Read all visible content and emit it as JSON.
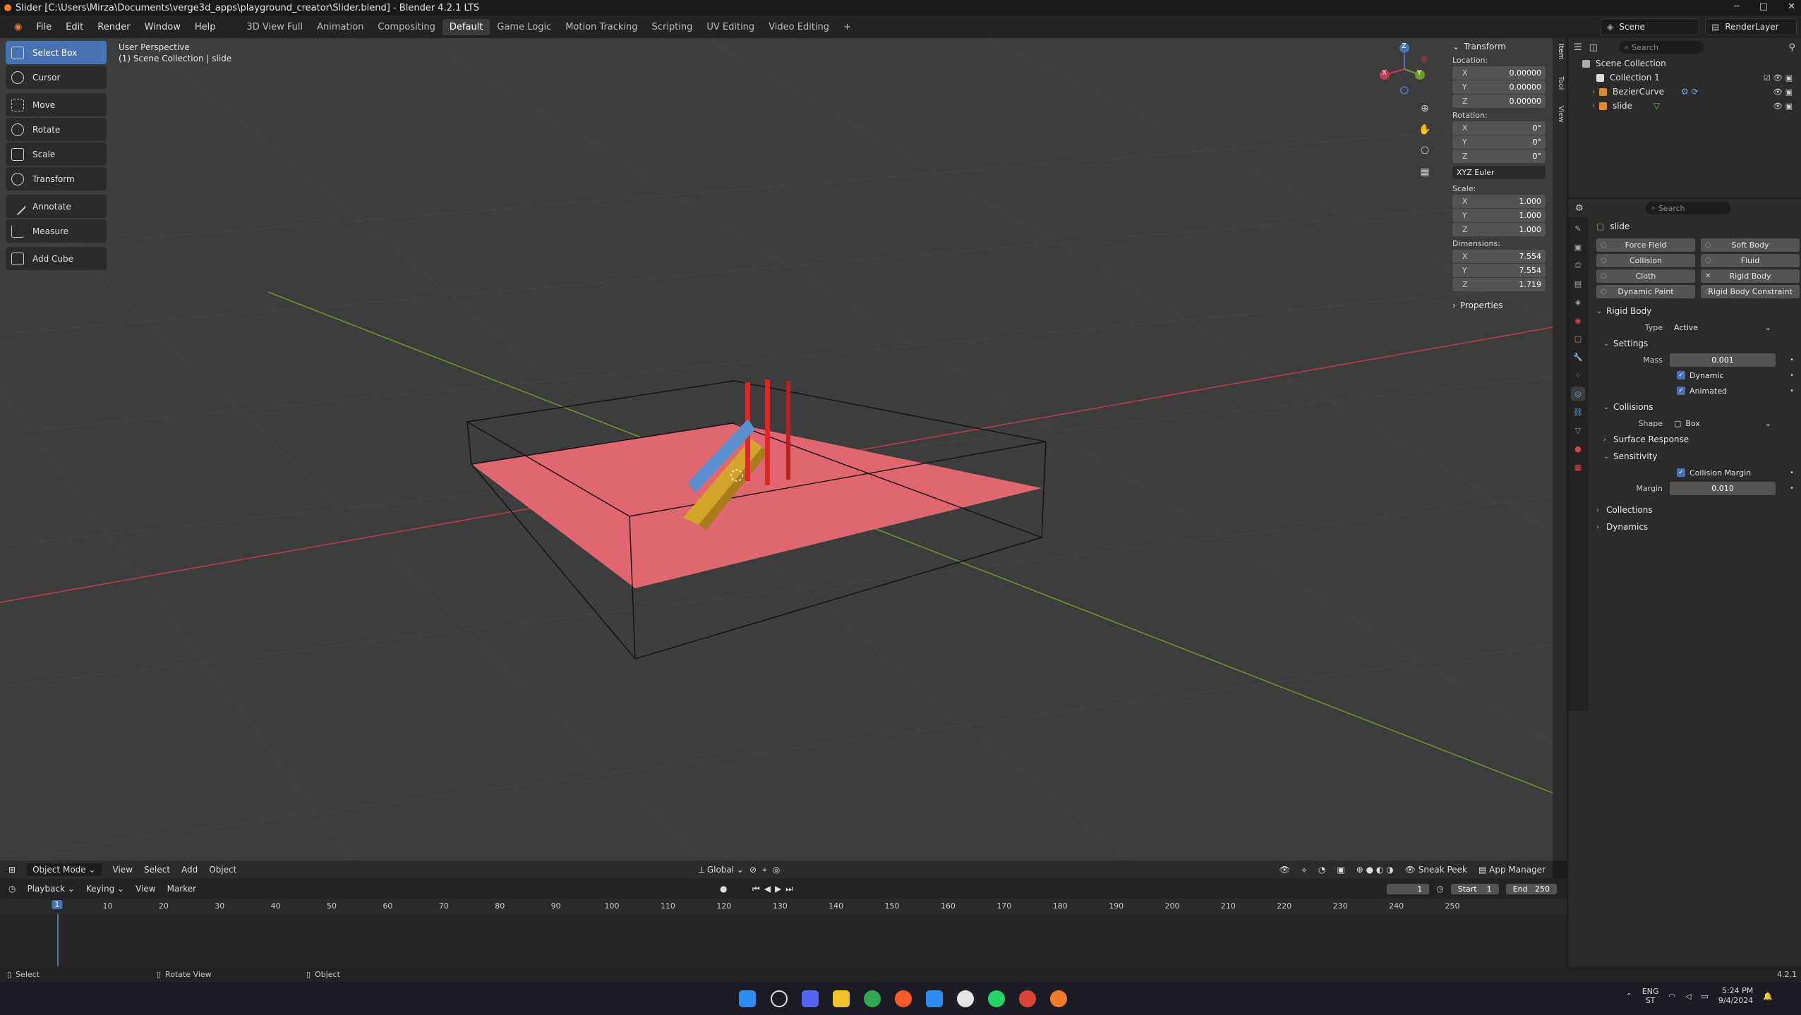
{
  "window": {
    "title": "Slider [C:\\Users\\Mirza\\Documents\\verge3d_apps\\playground_creator\\Slider.blend] - Blender 4.2.1 LTS",
    "btn_min": "─",
    "btn_max": "□",
    "btn_close": "✕"
  },
  "menu": {
    "file": "File",
    "edit": "Edit",
    "render": "Render",
    "window": "Window",
    "help": "Help"
  },
  "workspaces": [
    "3D View Full",
    "Animation",
    "Compositing",
    "Default",
    "Game Logic",
    "Motion Tracking",
    "Scripting",
    "UV Editing",
    "Video Editing"
  ],
  "workspace_add": "+",
  "scene": {
    "name": "Scene",
    "layer": "RenderLayer"
  },
  "viewport": {
    "perspective": "User Perspective",
    "collection": "(1) Scene Collection | slide"
  },
  "tools": {
    "select_box": "Select Box",
    "cursor": "Cursor",
    "move": "Move",
    "rotate": "Rotate",
    "scale": "Scale",
    "transform": "Transform",
    "annotate": "Annotate",
    "measure": "Measure",
    "add_cube": "Add Cube"
  },
  "gizmo": {
    "x": "X",
    "y": "Y",
    "z": "Z"
  },
  "npanel": {
    "header": "Transform",
    "location_label": "Location:",
    "location": {
      "x": "0.00000",
      "y": "0.00000",
      "z": "0.00000"
    },
    "rotation_label": "Rotation:",
    "rotation": {
      "x": "0°",
      "y": "0°",
      "z": "0°"
    },
    "rotation_mode": "XYZ Euler",
    "scale_label": "Scale:",
    "scale": {
      "x": "1.000",
      "y": "1.000",
      "z": "1.000"
    },
    "dimensions_label": "Dimensions:",
    "dimensions": {
      "x": "7.554",
      "y": "7.554",
      "z": "1.719"
    },
    "properties": "Properties",
    "ax_x": "X",
    "ax_y": "Y",
    "ax_z": "Z"
  },
  "side_tabs": {
    "item": "Item",
    "tool": "Tool",
    "view": "View"
  },
  "outliner": {
    "search": "Search",
    "scene_collection": "Scene Collection",
    "collection1": "Collection 1",
    "bezier": "BezierCurve",
    "slide": "slide"
  },
  "properties": {
    "search": "Search",
    "object_name": "slide",
    "physics": {
      "force_field": "Force Field",
      "soft_body": "Soft Body",
      "collision": "Collision",
      "fluid": "Fluid",
      "cloth": "Cloth",
      "rigid_body": "Rigid Body",
      "dynamic_paint": "Dynamic Paint",
      "rigid_body_constraint": "Rigid Body Constraint"
    },
    "rigid_body_header": "Rigid Body",
    "type_label": "Type",
    "type_value": "Active",
    "settings": "Settings",
    "mass_label": "Mass",
    "mass_value": "0.001",
    "dynamic": "Dynamic",
    "animated": "Animated",
    "collisions": "Collisions",
    "shape_label": "Shape",
    "shape_value": "Box",
    "surface_response": "Surface Response",
    "sensitivity": "Sensitivity",
    "collision_margin": "Collision Margin",
    "margin_label": "Margin",
    "margin_value": "0.010",
    "collections": "Collections",
    "dynamics": "Dynamics"
  },
  "viewport_header": {
    "mode": "Object Mode",
    "view": "View",
    "select": "Select",
    "add": "Add",
    "object": "Object",
    "orientation": "Global",
    "sneak_peek": "Sneak Peek",
    "app_manager": "App Manager"
  },
  "timeline": {
    "playback": "Playback",
    "keying": "Keying",
    "view": "View",
    "marker": "Marker",
    "current_frame": "1",
    "start_label": "Start",
    "start": "1",
    "end_label": "End",
    "end": "250",
    "ticks": [
      "10",
      "20",
      "30",
      "40",
      "50",
      "60",
      "70",
      "80",
      "90",
      "100",
      "110",
      "120",
      "130",
      "140",
      "150",
      "160",
      "170",
      "180",
      "190",
      "200",
      "210",
      "220",
      "230",
      "240",
      "250"
    ],
    "cursor": "1"
  },
  "statusbar": {
    "select": "Select",
    "rotate_view": "Rotate View",
    "object": "Object",
    "version": "4.2.1"
  },
  "taskbar": {
    "lang": "ENG",
    "region": "ST",
    "time": "5:24 PM",
    "date": "9/4/2024"
  },
  "colors": {
    "accent": "#4772b3",
    "floor": "#e06670",
    "slide_red": "#d92a2a",
    "slide_yellow": "#d4a52a",
    "x_axis": "#c43c4c",
    "y_axis": "#6f9a2c"
  }
}
